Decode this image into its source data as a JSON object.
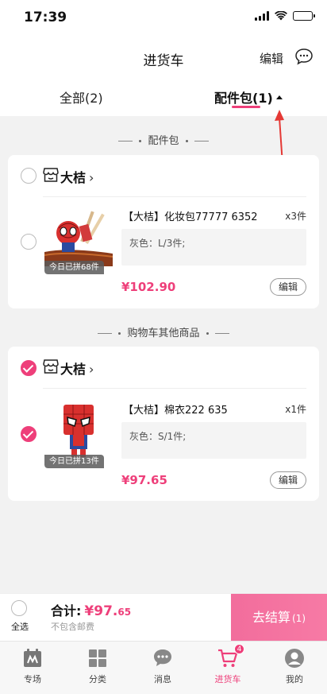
{
  "status_bar": {
    "time": "17:39"
  },
  "nav": {
    "title": "进货车",
    "edit_label": "编辑"
  },
  "tabs": [
    {
      "label": "全部(2)",
      "active": false
    },
    {
      "label": "配件包(1)",
      "active": true
    }
  ],
  "sections": [
    {
      "header": "配件包",
      "store": {
        "name": "大桔",
        "checked": false
      },
      "product": {
        "title": "【大桔】化妆包77777 6352",
        "qty": "x3件",
        "spec": "灰色：L/3件;",
        "price": "¥102.90",
        "badge": "今日已拼68件",
        "checked": false,
        "edit_label": "编辑"
      }
    },
    {
      "header": "购物车其他商品",
      "store": {
        "name": "大桔",
        "checked": true
      },
      "product": {
        "title": "【大桔】棉衣222 635",
        "qty": "x1件",
        "spec": "灰色：S/1件;",
        "price": "¥97.65",
        "badge": "今日已拼13件",
        "checked": true,
        "edit_label": "编辑"
      }
    }
  ],
  "footer": {
    "select_all_label": "全选",
    "total_label": "合计:",
    "total_currency": "¥97.",
    "total_cents": "65",
    "shipping_note": "不包含邮费",
    "checkout_label": "去结算",
    "checkout_count": "(1)"
  },
  "tabbar": [
    {
      "label": "专场",
      "icon": "special-icon"
    },
    {
      "label": "分类",
      "icon": "category-icon"
    },
    {
      "label": "消息",
      "icon": "message-icon"
    },
    {
      "label": "进货车",
      "icon": "cart-icon",
      "badge": "4",
      "active": true
    },
    {
      "label": "我的",
      "icon": "profile-icon"
    }
  ],
  "colors": {
    "accent": "#ee3f7a"
  }
}
